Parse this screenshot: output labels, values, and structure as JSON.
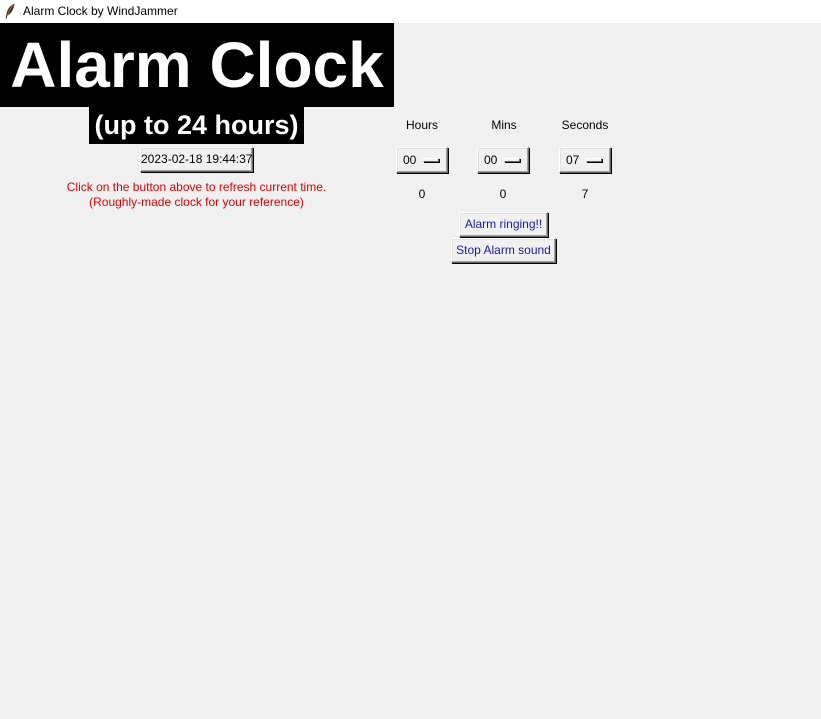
{
  "window": {
    "title": "Alarm Clock by WindJammer",
    "icon": "feather-icon"
  },
  "header": {
    "title": "Alarm Clock",
    "subtitle": "(up to 24 hours)"
  },
  "clock": {
    "current_time": "2023-02-18 19:44:37",
    "hint_line1": "Click on the button above to refresh current time.",
    "hint_line2": "(Roughly-made clock for your reference)"
  },
  "alarm": {
    "columns": {
      "hours": "Hours",
      "mins": "Mins",
      "seconds": "Seconds"
    },
    "selected": {
      "hours": "00",
      "mins": "00",
      "seconds": "07"
    },
    "values": {
      "hours": "0",
      "mins": "0",
      "seconds": "7"
    },
    "status_button": "Alarm ringing!!",
    "stop_button": "Stop Alarm sound"
  },
  "colors": {
    "background": "#f0f0f0",
    "title_bg": "#000000",
    "title_fg": "#ffffff",
    "hint_text": "#dd0000",
    "button_text_blue": "#1a1a9f"
  }
}
